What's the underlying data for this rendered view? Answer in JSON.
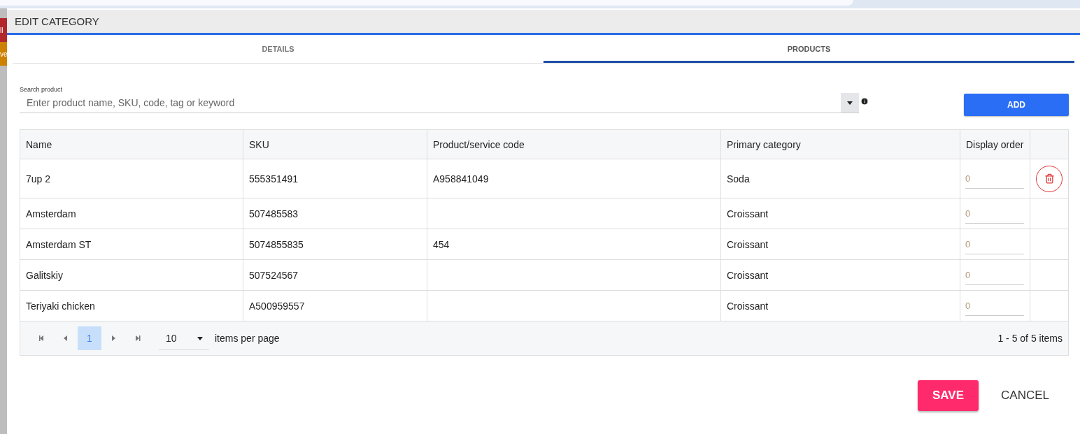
{
  "background": {
    "strip_texts": [
      "ll",
      "ve"
    ]
  },
  "dialog": {
    "title": "EDIT CATEGORY"
  },
  "tabs": [
    {
      "label": "DETAILS",
      "selected": false
    },
    {
      "label": "PRODUCTS",
      "selected": true
    }
  ],
  "search": {
    "label": "Search product",
    "placeholder": "Enter product name, SKU, code, tag or keyword"
  },
  "add_button": "ADD",
  "table": {
    "columns": [
      "Name",
      "SKU",
      "Product/service code",
      "Primary category",
      "Display order"
    ],
    "rows": [
      {
        "name": "7up 2",
        "sku": "555351491",
        "code": "A958841049",
        "category": "Soda",
        "order": "0",
        "deletable": true
      },
      {
        "name": "Amsterdam",
        "sku": "507485583",
        "code": "",
        "category": "Croissant",
        "order": "0",
        "deletable": false
      },
      {
        "name": "Amsterdam ST",
        "sku": "5074855835",
        "code": "454",
        "category": "Croissant",
        "order": "0",
        "deletable": false
      },
      {
        "name": "Galitskiy",
        "sku": "507524567",
        "code": "",
        "category": "Croissant",
        "order": "0",
        "deletable": false
      },
      {
        "name": "Teriyaki chicken",
        "sku": "A500959557",
        "code": "",
        "category": "Croissant",
        "order": "0",
        "deletable": false
      }
    ]
  },
  "pager": {
    "pages": [
      {
        "label": "1",
        "selected": true
      }
    ],
    "page_size": "10",
    "page_size_label": "items per page",
    "summary": "1 - 5 of 5 items"
  },
  "footer": {
    "save": "SAVE",
    "cancel": "CANCEL"
  }
}
